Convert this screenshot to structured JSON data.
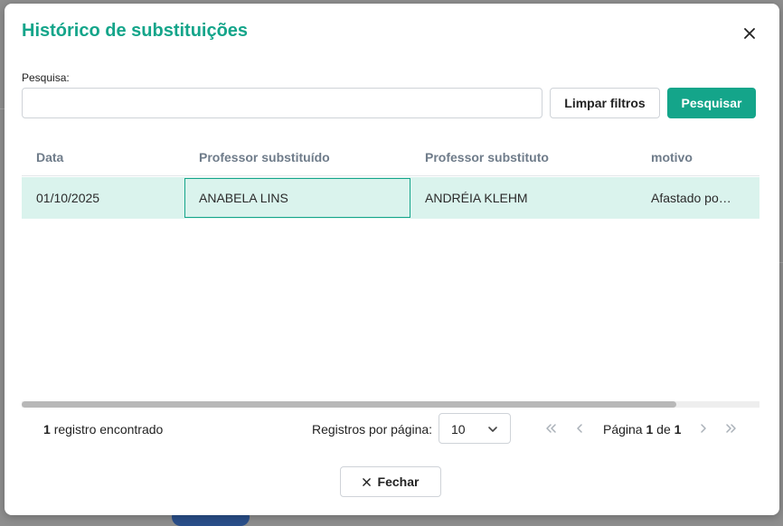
{
  "dialog": {
    "title": "Histórico de substituições",
    "search_label": "Pesquisa:",
    "search_value": "",
    "clear_button": "Limpar filtros",
    "search_button": "Pesquisar",
    "close_icon": "close-icon"
  },
  "table": {
    "columns": [
      "Data",
      "Professor substituído",
      "Professor substituto",
      "motivo"
    ],
    "rows": [
      [
        "01/10/2025",
        "ANABELA LINS",
        "ANDRÉIA KLEHM",
        "Afastado po…"
      ]
    ]
  },
  "footer": {
    "records_count": "1",
    "records_text": "registro encontrado",
    "per_page_label": "Registros por página:",
    "per_page_value": "10",
    "page_prefix": "Página",
    "current_page": "1",
    "page_of": "de",
    "total_pages": "1",
    "close_button": "Fechar"
  },
  "colors": {
    "accent": "#14a58a",
    "selected_row": "#daf3ed"
  }
}
